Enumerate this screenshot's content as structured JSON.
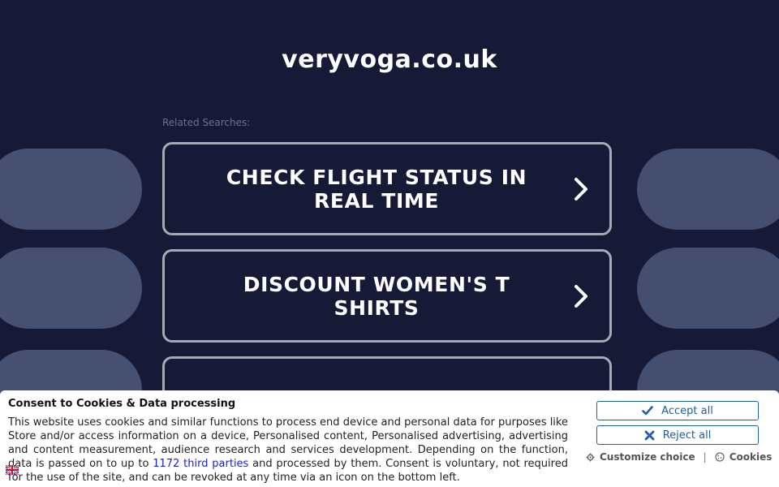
{
  "site": {
    "title": "veryvoga.co.uk"
  },
  "related": {
    "label": "Related Searches:"
  },
  "searches": [
    {
      "label": "CHECK FLIGHT STATUS IN REAL TIME",
      "icon": "chevron-right-icon"
    },
    {
      "label": "DISCOUNT WOMEN'S T SHIRTS",
      "icon": "chevron-right-icon"
    },
    {
      "label": "",
      "icon": ""
    }
  ],
  "consent": {
    "title": "Consent to Cookies & Data processing",
    "text_before_link": "This website uses cookies and similar functions to process end device and personal data for purposes like Store and/or access information on a device, Personalised content, Personalised advertising, advertising and content measurement, audience research and services development. Depending on the function, data is passed on to up to ",
    "link_text": "1172 third parties",
    "text_after_link": " and processed by them. Consent is voluntary, not required for the use of the site, and can be revoked at any time via an icon on the bottom left.",
    "accept_label": "Accept all",
    "reject_label": "Reject all",
    "customize_label": "Customize choice",
    "separator": "|",
    "cookies_label": "Cookies"
  },
  "colors": {
    "background": "#161a36",
    "decor_pill": "#475071",
    "button_border": "#a7a9b5",
    "consent_accent": "#1a5fa8",
    "link": "#1a21c8"
  }
}
